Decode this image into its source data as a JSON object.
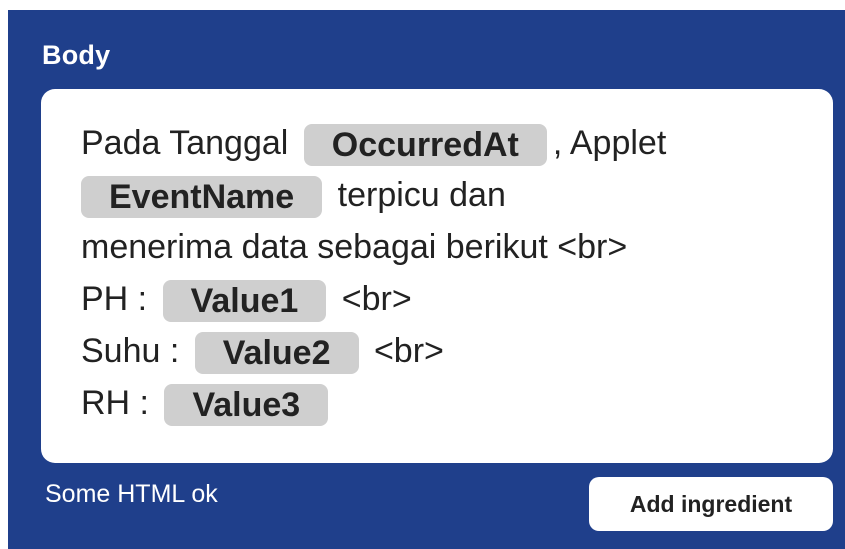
{
  "section": {
    "label": "Body"
  },
  "editor": {
    "line1": {
      "text_before": "Pada Tanggal ",
      "token": "OccurredAt",
      "text_after": ", Applet"
    },
    "line2": {
      "token": "EventName",
      "text_after": " terpicu dan"
    },
    "line3": {
      "text": "menerima data sebagai berikut <br>"
    },
    "line4": {
      "text_before": "PH : ",
      "token": "Value1",
      "text_after": " <br>"
    },
    "line5": {
      "text_before": "Suhu : ",
      "token": "Value2",
      "text_after": " <br>"
    },
    "line6": {
      "text_before": "RH : ",
      "token": "Value3"
    }
  },
  "footer": {
    "hint": "Some HTML ok",
    "add_ingredient_label": "Add ingredient"
  },
  "colors": {
    "panel_background": "#1f3f8b",
    "editor_background": "#ffffff",
    "token_background": "#cfcfcf",
    "text": "#222222"
  }
}
